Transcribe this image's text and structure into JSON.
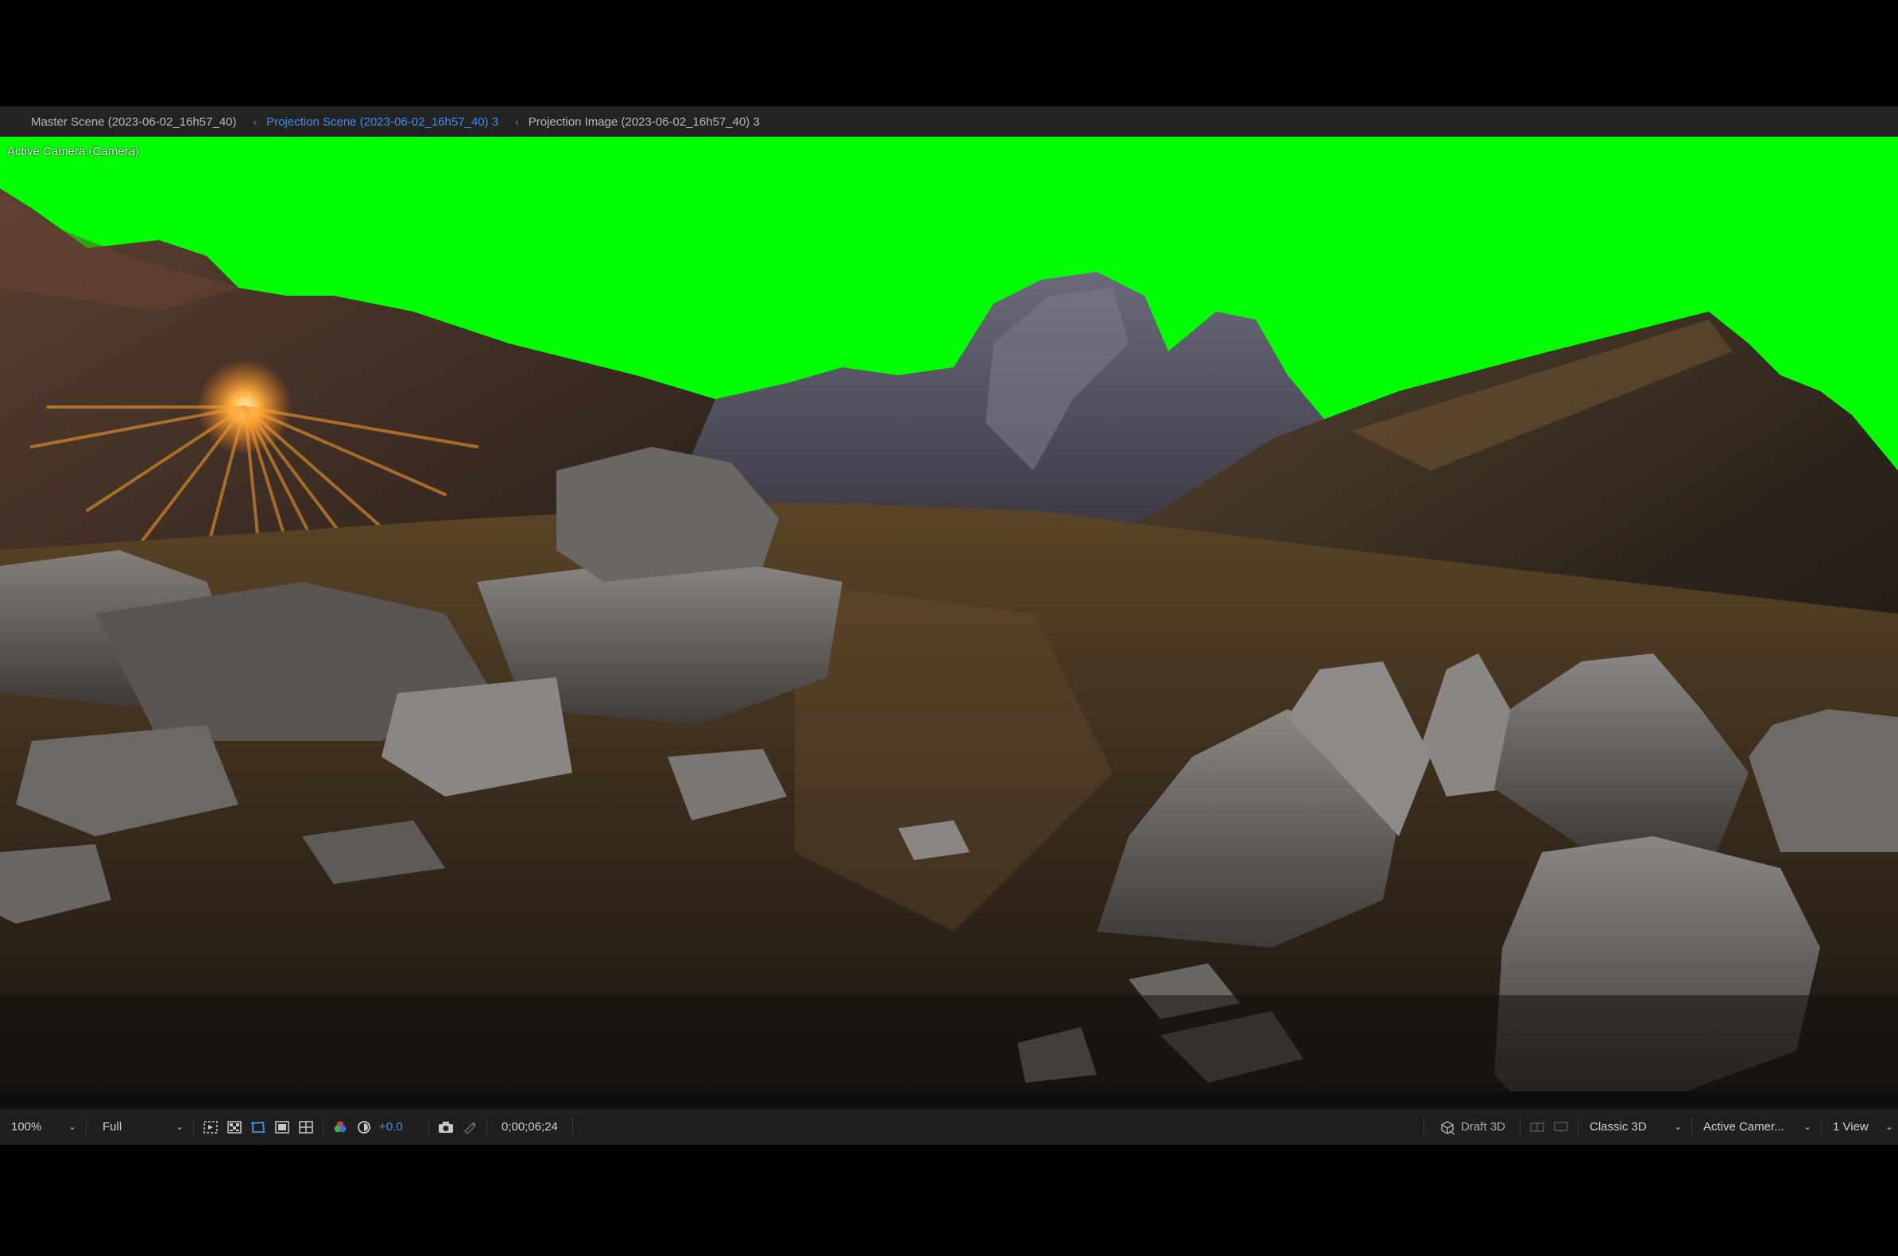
{
  "breadcrumb": {
    "items": [
      {
        "label": "Master Scene (2023-06-02_16h57_40)",
        "active": false
      },
      {
        "label": "Projection Scene (2023-06-02_16h57_40) 3",
        "active": true
      },
      {
        "label": "Projection Image (2023-06-02_16h57_40) 3",
        "active": false
      }
    ],
    "separator": "‹"
  },
  "viewer": {
    "camera_label": "Active Camera (Camera)",
    "background_color": "#00ff00"
  },
  "toolbar": {
    "magnification": "100%",
    "resolution": "Full",
    "exposure": "+0.0",
    "timecode": "0;00;06;24",
    "draft_3d": "Draft 3D",
    "renderer": "Classic 3D",
    "camera_view": "Active Camer...",
    "view_layout": "1 View",
    "icons": [
      "region-of-interest-icon",
      "transparency-grid-icon",
      "mask-path-icon",
      "safe-margins-icon",
      "grid-guides-icon",
      "color-channels-icon",
      "reset-exposure-icon",
      "snapshot-camera-icon",
      "show-snapshot-icon",
      "draft-3d-icon",
      "extended-viewer-icon",
      "fast-previews-icon"
    ],
    "accent_color": "#3f8ff2"
  }
}
